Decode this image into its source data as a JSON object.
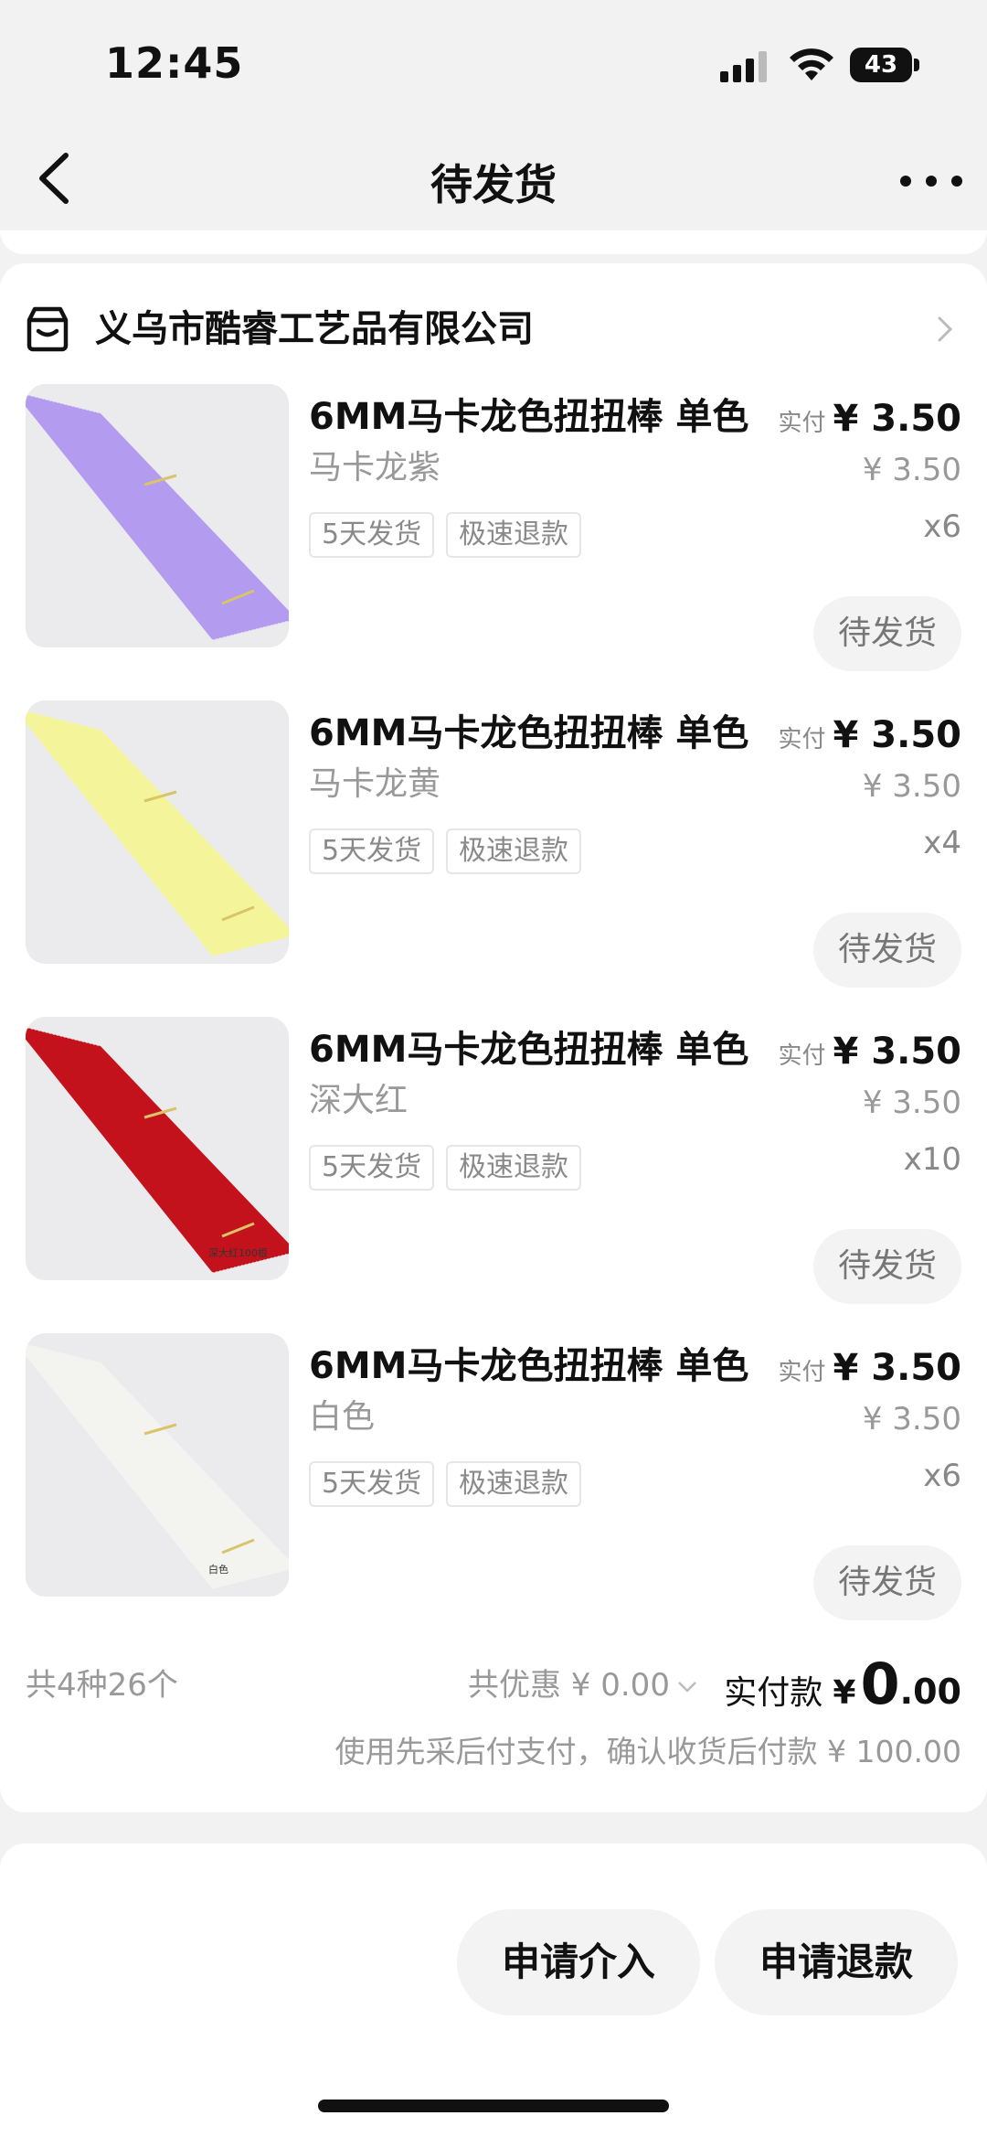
{
  "status_bar": {
    "time": "12:45",
    "battery": "43"
  },
  "nav": {
    "title": "待发货"
  },
  "shop": {
    "name": "义乌市酷睿工艺品有限公司"
  },
  "items": [
    {
      "title": "6MM马卡龙色扭扭棒 单色",
      "sku": "马卡龙紫",
      "tag1": "5天发货",
      "tag2": "极速退款",
      "paid_label": "实付",
      "paid": "¥ 3.50",
      "original": "¥ 3.50",
      "qty": "x6",
      "status": "待发货",
      "color": "#b39cf0"
    },
    {
      "title": "6MM马卡龙色扭扭棒 单色",
      "sku": "马卡龙黄",
      "tag1": "5天发货",
      "tag2": "极速退款",
      "paid_label": "实付",
      "paid": "¥ 3.50",
      "original": "¥ 3.50",
      "qty": "x4",
      "status": "待发货",
      "color": "#f4f59a"
    },
    {
      "title": "6MM马卡龙色扭扭棒 单色",
      "sku": "深大红",
      "tag1": "5天发货",
      "tag2": "极速退款",
      "paid_label": "实付",
      "paid": "¥ 3.50",
      "original": "¥ 3.50",
      "qty": "x10",
      "status": "待发货",
      "color": "#c4121c",
      "photo_label": "深大红100根"
    },
    {
      "title": "6MM马卡龙色扭扭棒 单色",
      "sku": "白色",
      "tag1": "5天发货",
      "tag2": "极速退款",
      "paid_label": "实付",
      "paid": "¥ 3.50",
      "original": "¥ 3.50",
      "qty": "x6",
      "status": "待发货",
      "color": "#f3f3f0",
      "photo_label": "白色"
    }
  ],
  "summary": {
    "count": "共4种26个",
    "discount": "共优惠 ¥ 0.00",
    "total_label": "实付款",
    "total_currency": "¥",
    "total_int": "0",
    "total_dec": ".00",
    "note": "使用先采后付支付，确认收货后付款 ¥ 100.00"
  },
  "actions": {
    "intervene": "申请介入",
    "refund": "申请退款"
  }
}
